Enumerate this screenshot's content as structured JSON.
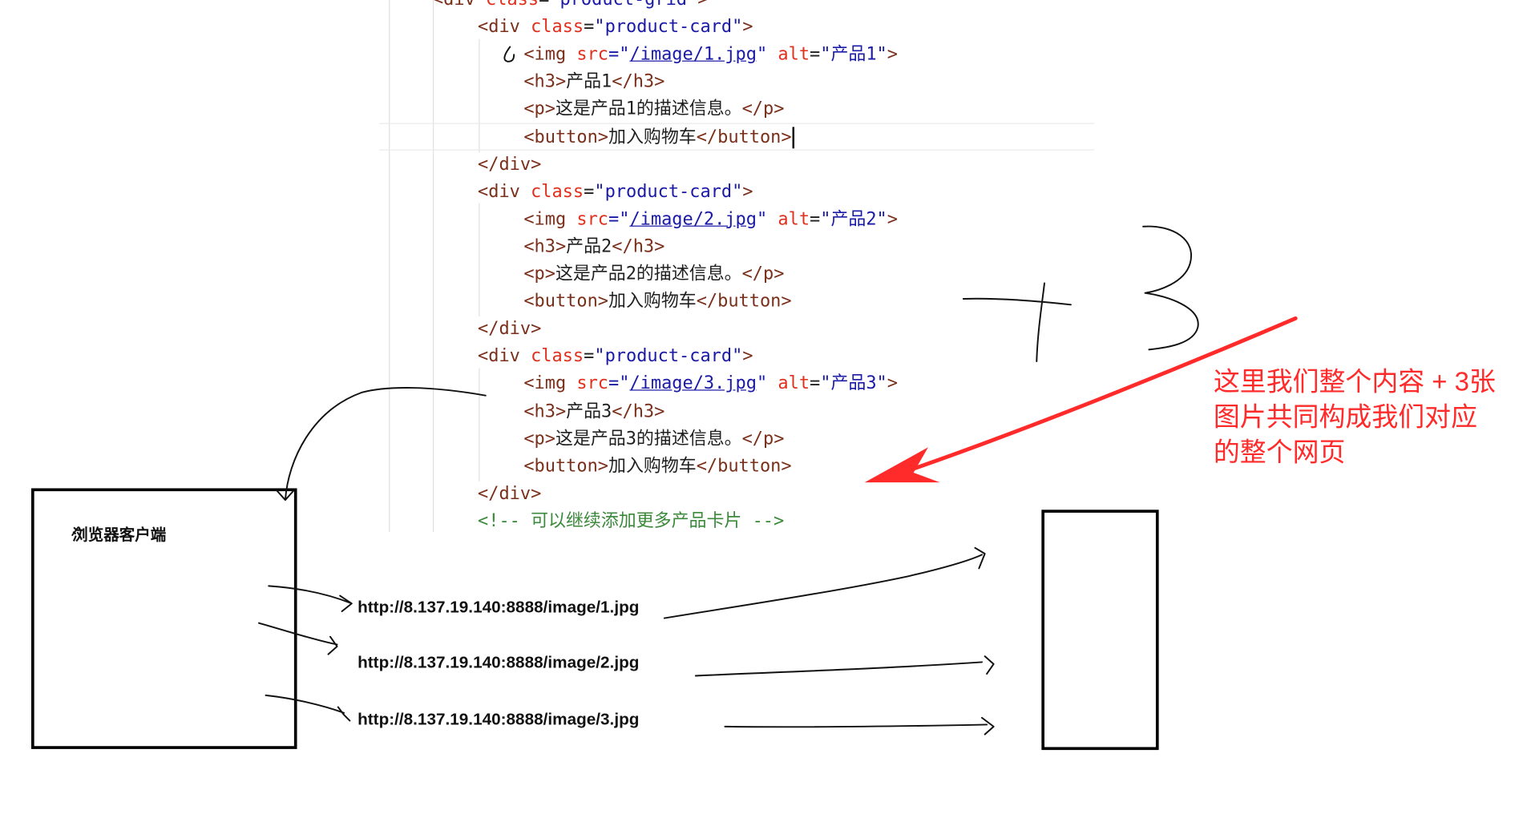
{
  "code": {
    "lines": [
      {
        "indent": 0,
        "parts": [
          {
            "t": "<div ",
            "c": "tg"
          },
          {
            "t": "class",
            "c": "at"
          },
          {
            "t": "=",
            "c": ""
          },
          {
            "t": "\"product-grid\"",
            "c": "st"
          },
          {
            "t": ">",
            "c": "tg"
          }
        ]
      },
      {
        "indent": 1,
        "parts": [
          {
            "t": "<div ",
            "c": "tg"
          },
          {
            "t": "class",
            "c": "at"
          },
          {
            "t": "=",
            "c": ""
          },
          {
            "t": "\"product-card\"",
            "c": "st"
          },
          {
            "t": ">",
            "c": "tg"
          }
        ]
      },
      {
        "indent": 2,
        "parts": [
          {
            "t": "<img ",
            "c": "tg"
          },
          {
            "t": "src",
            "c": "at"
          },
          {
            "t": "=\"",
            "c": "st"
          },
          {
            "t": "/image/1.jpg",
            "c": "lk"
          },
          {
            "t": "\" ",
            "c": "st"
          },
          {
            "t": "alt",
            "c": "at"
          },
          {
            "t": "=",
            "c": ""
          },
          {
            "t": "\"产品1\"",
            "c": "st"
          },
          {
            "t": ">",
            "c": "tg"
          }
        ]
      },
      {
        "indent": 2,
        "parts": [
          {
            "t": "<h3>",
            "c": "tg"
          },
          {
            "t": "产品1",
            "c": ""
          },
          {
            "t": "</h3>",
            "c": "tg"
          }
        ]
      },
      {
        "indent": 2,
        "parts": [
          {
            "t": "<p>",
            "c": "tg"
          },
          {
            "t": "这是产品1的描述信息。",
            "c": ""
          },
          {
            "t": "</p>",
            "c": "tg"
          }
        ]
      },
      {
        "indent": 2,
        "caret": true,
        "parts": [
          {
            "t": "<button>",
            "c": "tg"
          },
          {
            "t": "加入购物车",
            "c": ""
          },
          {
            "t": "</button>",
            "c": "tg"
          }
        ]
      },
      {
        "indent": 1,
        "parts": [
          {
            "t": "</div>",
            "c": "tg"
          }
        ]
      },
      {
        "indent": 1,
        "parts": [
          {
            "t": "<div ",
            "c": "tg"
          },
          {
            "t": "class",
            "c": "at"
          },
          {
            "t": "=",
            "c": ""
          },
          {
            "t": "\"product-card\"",
            "c": "st"
          },
          {
            "t": ">",
            "c": "tg"
          }
        ]
      },
      {
        "indent": 2,
        "parts": [
          {
            "t": "<img ",
            "c": "tg"
          },
          {
            "t": "src",
            "c": "at"
          },
          {
            "t": "=\"",
            "c": "st"
          },
          {
            "t": "/image/2.jpg",
            "c": "lk"
          },
          {
            "t": "\" ",
            "c": "st"
          },
          {
            "t": "alt",
            "c": "at"
          },
          {
            "t": "=",
            "c": ""
          },
          {
            "t": "\"产品2\"",
            "c": "st"
          },
          {
            "t": ">",
            "c": "tg"
          }
        ]
      },
      {
        "indent": 2,
        "parts": [
          {
            "t": "<h3>",
            "c": "tg"
          },
          {
            "t": "产品2",
            "c": ""
          },
          {
            "t": "</h3>",
            "c": "tg"
          }
        ]
      },
      {
        "indent": 2,
        "parts": [
          {
            "t": "<p>",
            "c": "tg"
          },
          {
            "t": "这是产品2的描述信息。",
            "c": ""
          },
          {
            "t": "</p>",
            "c": "tg"
          }
        ]
      },
      {
        "indent": 2,
        "parts": [
          {
            "t": "<button>",
            "c": "tg"
          },
          {
            "t": "加入购物车",
            "c": ""
          },
          {
            "t": "</button>",
            "c": "tg"
          }
        ]
      },
      {
        "indent": 1,
        "parts": [
          {
            "t": "</div>",
            "c": "tg"
          }
        ]
      },
      {
        "indent": 1,
        "parts": [
          {
            "t": "<div ",
            "c": "tg"
          },
          {
            "t": "class",
            "c": "at"
          },
          {
            "t": "=",
            "c": ""
          },
          {
            "t": "\"product-card\"",
            "c": "st"
          },
          {
            "t": ">",
            "c": "tg"
          }
        ]
      },
      {
        "indent": 2,
        "parts": [
          {
            "t": "<img ",
            "c": "tg"
          },
          {
            "t": "src",
            "c": "at"
          },
          {
            "t": "=\"",
            "c": "st"
          },
          {
            "t": "/image/3.jpg",
            "c": "lk"
          },
          {
            "t": "\" ",
            "c": "st"
          },
          {
            "t": "alt",
            "c": "at"
          },
          {
            "t": "=",
            "c": ""
          },
          {
            "t": "\"产品3\"",
            "c": "st"
          },
          {
            "t": ">",
            "c": "tg"
          }
        ]
      },
      {
        "indent": 2,
        "parts": [
          {
            "t": "<h3>",
            "c": "tg"
          },
          {
            "t": "产品3",
            "c": ""
          },
          {
            "t": "</h3>",
            "c": "tg"
          }
        ]
      },
      {
        "indent": 2,
        "parts": [
          {
            "t": "<p>",
            "c": "tg"
          },
          {
            "t": "这是产品3的描述信息。",
            "c": ""
          },
          {
            "t": "</p>",
            "c": "tg"
          }
        ]
      },
      {
        "indent": 2,
        "parts": [
          {
            "t": "<button>",
            "c": "tg"
          },
          {
            "t": "加入购物车",
            "c": ""
          },
          {
            "t": "</button>",
            "c": "tg"
          }
        ]
      },
      {
        "indent": 1,
        "parts": [
          {
            "t": "</div>",
            "c": "tg"
          }
        ]
      },
      {
        "indent": 1,
        "parts": [
          {
            "t": "<!-- 可以继续添加更多产品卡片 -->",
            "c": "cm"
          }
        ]
      }
    ]
  },
  "diagram": {
    "client_label": "浏览器客户端",
    "urls": [
      "http://8.137.19.140:8888/image/1.jpg",
      "http://8.137.19.140:8888/image/2.jpg",
      "http://8.137.19.140:8888/image/3.jpg"
    ],
    "plus_annotation": "+3",
    "note_lines": [
      "这里我们整个内容 + 3张",
      "图片共同构成我们对应",
      "的整个网页"
    ]
  },
  "colors": {
    "annotation_red": "#ff2a2a",
    "tag": "#7a2f1a",
    "attribute": "#e0301e",
    "string": "#1a1aa6",
    "comment": "#3b8a3b"
  }
}
